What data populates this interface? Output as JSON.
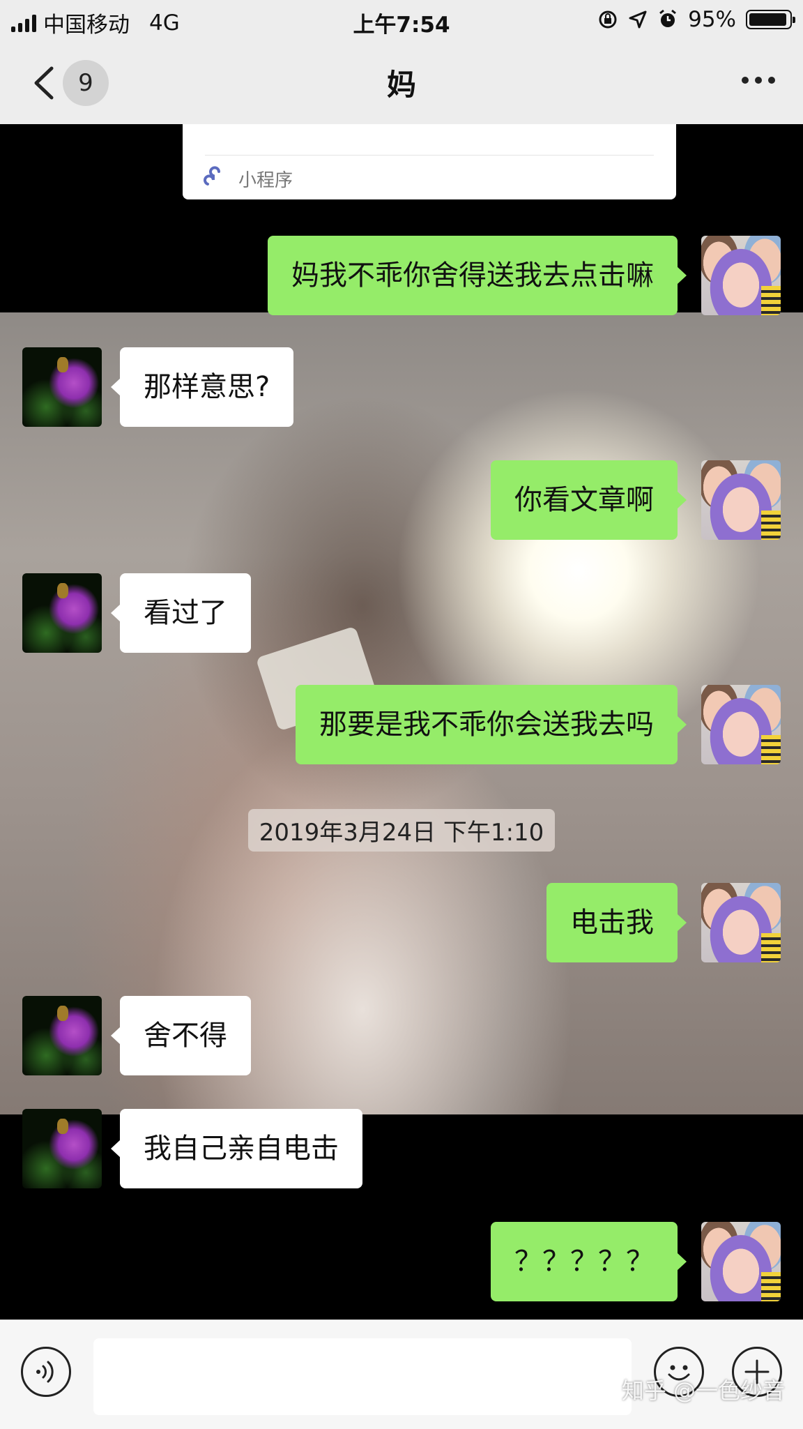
{
  "status_bar": {
    "carrier": "中国移动",
    "network": "4G",
    "time": "上午7:54",
    "battery": "95%",
    "battery_level": 0.95
  },
  "nav": {
    "unread_count": "9",
    "title": "妈"
  },
  "mini_program_card": {
    "label": "小程序"
  },
  "messages": [
    {
      "side": "out",
      "text": "妈我不乖你舍得送我去点击嘛"
    },
    {
      "side": "in",
      "text": "那样意思?"
    },
    {
      "side": "out",
      "text": "你看文章啊"
    },
    {
      "side": "in",
      "text": "看过了"
    },
    {
      "side": "out",
      "text": "那要是我不乖你会送我去吗"
    },
    {
      "side": "out",
      "text": "电击我"
    },
    {
      "side": "in",
      "text": "舍不得"
    },
    {
      "side": "in",
      "text": "我自己亲自电击"
    },
    {
      "side": "out",
      "text": "？？？？？"
    }
  ],
  "timestamp": "2019年3月24日 下午1:10",
  "input_bar": {
    "placeholder": ""
  },
  "watermark": "知乎 @一色纱音",
  "colors": {
    "outgoing_bubble": "#95ec69",
    "incoming_bubble": "#ffffff",
    "nav_background": "#ededed"
  }
}
